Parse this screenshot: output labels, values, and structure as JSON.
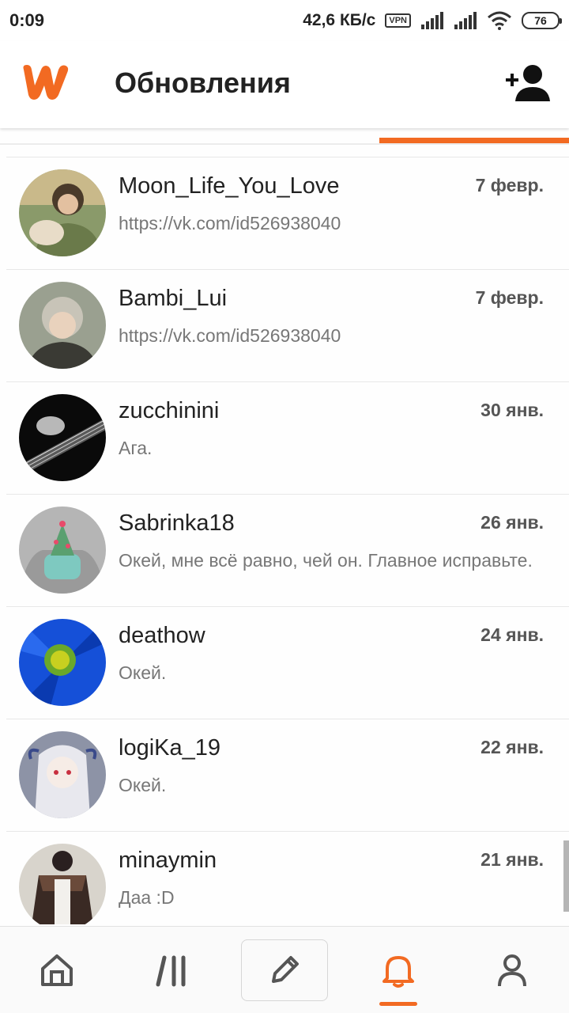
{
  "status_bar": {
    "time": "0:09",
    "speed": "42,6 КБ/с",
    "vpn": "VPN",
    "battery": "76"
  },
  "header": {
    "title": "Обновления",
    "logo_icon": "wattpad-logo",
    "add_user_icon": "add-user-icon"
  },
  "accent_color": "#f26a22",
  "messages": [
    {
      "name": "Moon_Life_You_Love",
      "date": "7 февр.",
      "text": "https://vk.com/id526938040"
    },
    {
      "name": "Bambi_Lui",
      "date": "7 февр.",
      "text": "https://vk.com/id526938040"
    },
    {
      "name": "zucchinini",
      "date": "30 янв.",
      "text": "Ага."
    },
    {
      "name": "Sabrinka18",
      "date": "26 янв.",
      "text": "Окей, мне всё равно, чей он. Главное исправьте."
    },
    {
      "name": "deathow",
      "date": "24 янв.",
      "text": "Окей."
    },
    {
      "name": "logiKa_19",
      "date": "22 янв.",
      "text": "Окей."
    },
    {
      "name": "minaymin",
      "date": "21 янв.",
      "text": "Даа :D"
    }
  ],
  "bottom_nav": [
    {
      "icon": "home-icon"
    },
    {
      "icon": "library-icon"
    },
    {
      "icon": "pencil-icon"
    },
    {
      "icon": "bell-icon",
      "active": true
    },
    {
      "icon": "profile-icon"
    }
  ]
}
